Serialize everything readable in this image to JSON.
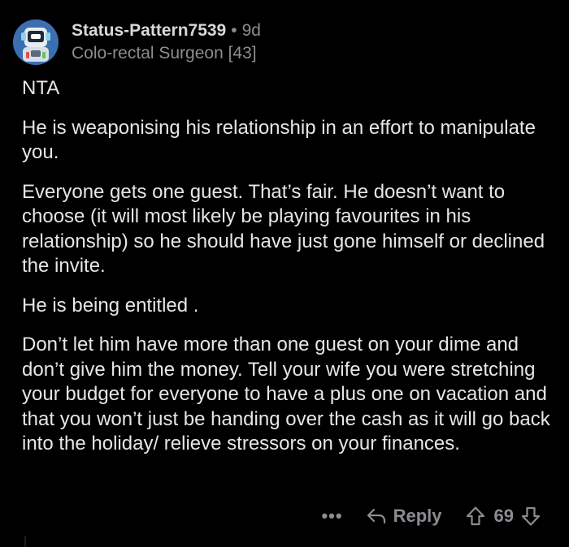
{
  "comment": {
    "author": {
      "username": "Status-Pattern7539",
      "separator": "•",
      "age": "9d",
      "flair": "Colo-rectal Surgeon [43]",
      "avatar_icon": "robot-avatar-icon"
    },
    "paragraphs": [
      "NTA",
      "He is weaponising his relationship in an effort to manipulate you.",
      "Everyone gets one guest. That’s fair. He doesn’t want to choose (it will most likely be playing favourites in his relationship) so he should have just gone himself or declined the invite.",
      "He is being entitled .",
      "Don’t let him have more than one guest on your dime and don’t give him the money. Tell your wife you were stretching your budget for everyone to have a plus one on vacation and that you won’t just be handing over the cash as it will go back into the holiday/ relieve stressors on your finances."
    ],
    "actions": {
      "more": "•••",
      "reply_label": "Reply",
      "score": "69"
    }
  },
  "colors": {
    "background": "#000000",
    "text": "#e4e6e8",
    "muted": "#8a8d91",
    "avatar_bg": "#3b6fb0"
  }
}
